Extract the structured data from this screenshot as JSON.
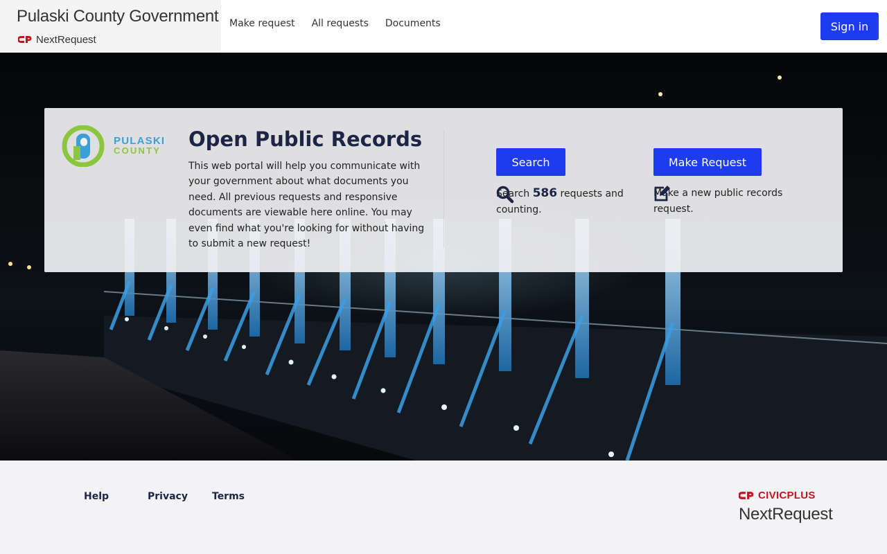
{
  "header": {
    "org_title": "Pulaski County Government",
    "product_name": "NextRequest",
    "nav": [
      "Make request",
      "All requests",
      "Documents"
    ],
    "sign_in_label": "Sign in"
  },
  "card": {
    "logo_text_line1": "PULASKI",
    "logo_text_line2": "COUNTY",
    "title": "Open Public Records",
    "description": "This web portal will help you communicate with your government about what documents you need. All previous requests and responsive documents are viewable here online. You may even find what you're looking for without having to submit a new request!",
    "search_button": "Search",
    "search_prefix": "Search",
    "search_count": "586",
    "search_suffix": "requests and counting.",
    "request_button": "Make Request",
    "request_text": "Make a new public records request."
  },
  "footer": {
    "links": [
      "Help",
      "Privacy",
      "Terms"
    ],
    "brand_line1": "CIVICPLUS",
    "brand_line2": "NextRequest"
  },
  "colors": {
    "primary_button": "#1f3bf0",
    "heading": "#1c2546",
    "brand_red": "#c3161c",
    "logo_green": "#8cc63f",
    "logo_blue": "#3aa0d8"
  },
  "icons": {
    "brand": "civicplus-logo-icon",
    "search": "magnifier-icon",
    "request": "edit-icon"
  }
}
